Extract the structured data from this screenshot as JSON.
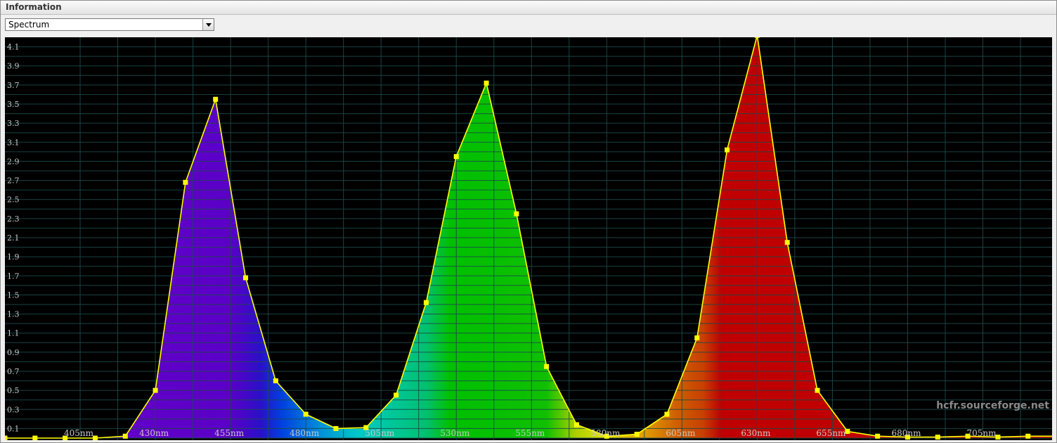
{
  "window": {
    "title": "Information"
  },
  "view_selector": {
    "selected": "Spectrum"
  },
  "watermark": "hcfr.sourceforge.net",
  "chart_data": {
    "type": "area",
    "title": "",
    "xlabel": "",
    "ylabel": "",
    "xlim": [
      380,
      728
    ],
    "ylim": [
      0,
      4.2
    ],
    "x_ticks": [
      405,
      430,
      455,
      480,
      505,
      530,
      555,
      580,
      605,
      630,
      655,
      680,
      705
    ],
    "x_tick_labels": [
      "405nm",
      "430nm",
      "455nm",
      "480nm",
      "505nm",
      "530nm",
      "555nm",
      "580nm",
      "605nm",
      "630nm",
      "655nm",
      "680nm",
      "705nm"
    ],
    "y_ticks": [
      0.1,
      0.3,
      0.5,
      0.7,
      0.9,
      1.1,
      1.3,
      1.5,
      1.7,
      1.9,
      2.1,
      2.3,
      2.5,
      2.7,
      2.9,
      3.1,
      3.3,
      3.5,
      3.7,
      3.9,
      4.1
    ],
    "y_tick_labels": [
      "0.1",
      "0.3",
      "0.5",
      "0.7",
      "0.9",
      "1.1",
      "1.3",
      "1.5",
      "1.7",
      "1.9",
      "2.1",
      "2.3",
      "2.5",
      "2.7",
      "2.9",
      "3.1",
      "3.3",
      "3.5",
      "3.7",
      "3.9",
      "4.1"
    ],
    "grid": true,
    "series": [
      {
        "x": [
          380,
          390,
          400,
          410,
          420,
          430,
          440,
          450,
          460,
          470,
          480,
          490,
          500,
          510,
          520,
          530,
          540,
          550,
          560,
          570,
          580,
          590,
          600,
          610,
          620,
          630,
          640,
          650,
          660,
          670,
          680,
          690,
          700,
          710,
          720,
          730
        ],
        "values": [
          0.0,
          0.0,
          0.0,
          0.0,
          0.02,
          0.5,
          2.68,
          3.55,
          1.68,
          0.6,
          0.25,
          0.1,
          0.11,
          0.45,
          1.42,
          2.95,
          3.72,
          2.35,
          0.75,
          0.14,
          0.02,
          0.04,
          0.25,
          1.05,
          3.02,
          4.22,
          2.05,
          0.5,
          0.07,
          0.02,
          0.01,
          0.01,
          0.02,
          0.01,
          0.02,
          0.02
        ]
      }
    ]
  }
}
